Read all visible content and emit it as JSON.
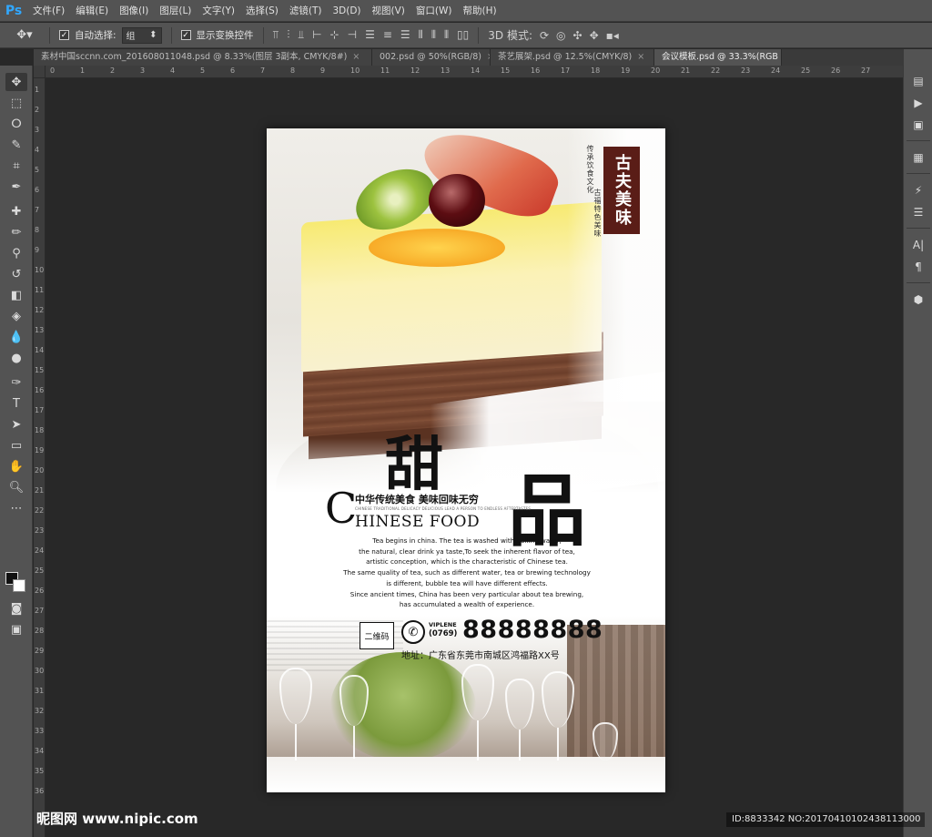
{
  "app": {
    "logo": "Ps"
  },
  "menu": [
    "文件(F)",
    "编辑(E)",
    "图像(I)",
    "图层(L)",
    "文字(Y)",
    "选择(S)",
    "滤镜(T)",
    "3D(D)",
    "视图(V)",
    "窗口(W)",
    "帮助(H)"
  ],
  "options": {
    "auto_select_label": "自动选择:",
    "auto_select_value": "组",
    "show_transform_label": "显示变换控件",
    "mode_3d_label": "3D 模式:"
  },
  "tabs": [
    {
      "label": "素材中国sccnn.com_201608011048.psd @ 8.33%(图层 3副本, CMYK/8#)",
      "active": false
    },
    {
      "label": "002.psd @ 50%(RGB/8)",
      "active": false
    },
    {
      "label": "茶艺展架.psd @ 12.5%(CMYK/8)",
      "active": false
    },
    {
      "label": "会议模板.psd @ 33.3%(RGB",
      "active": true
    }
  ],
  "ruler_ticks": [
    "0",
    "1",
    "2",
    "3",
    "4",
    "5",
    "6",
    "7",
    "8",
    "9",
    "10",
    "11",
    "12",
    "13",
    "14",
    "15",
    "16",
    "17",
    "18",
    "19",
    "20",
    "21",
    "22",
    "23",
    "24",
    "25",
    "26",
    "27"
  ],
  "ruler_v_ticks": [
    "1",
    "2",
    "3",
    "4",
    "5",
    "6",
    "7",
    "8",
    "9",
    "10",
    "11",
    "12",
    "13",
    "14",
    "15",
    "16",
    "17",
    "18",
    "19",
    "20",
    "21",
    "22",
    "23",
    "24",
    "25",
    "26",
    "27",
    "28",
    "29",
    "30",
    "31",
    "32",
    "33",
    "34",
    "35",
    "36"
  ],
  "poster": {
    "seal_text": "古夫美味",
    "seal_side_1": "传承饮食文化",
    "seal_side_2": "古福特色美味",
    "title_1": "甜",
    "title_2": "品",
    "big_c": "C",
    "subtitle_cn": "中华传统美食  美味回味无穷",
    "subtitle_tiny": "CHINESE TRADITIONAL DELICACY DELICIOUS LEAD A PERSON TO ENDLESS AFTERTASTES",
    "subtitle_en": "HINESE FOOD",
    "paragraph": [
      "Tea begins in china. The tea is washed with boiling water,",
      "the natural, clear drink ya taste,To seek the inherent flavor of tea,",
      "artistic conception, which is the characteristic of Chinese tea.",
      "The same quality of tea, such as different water, tea or brewing technology",
      "is different, bubble tea will have different effects.",
      "Since ancient times, China has been very particular about tea brewing,",
      "has accumulated a wealth of experience."
    ],
    "qr_label": "二维码",
    "phone_brand": "VIPLENE",
    "area_code": "(0769)",
    "phone_number": "88888888",
    "address": "地址：广东省东莞市南城区鸿福路XX号"
  },
  "watermark": {
    "left": "昵图网 www.nipic.com",
    "right": "ID:8833342 NO:20170410102438113000"
  }
}
